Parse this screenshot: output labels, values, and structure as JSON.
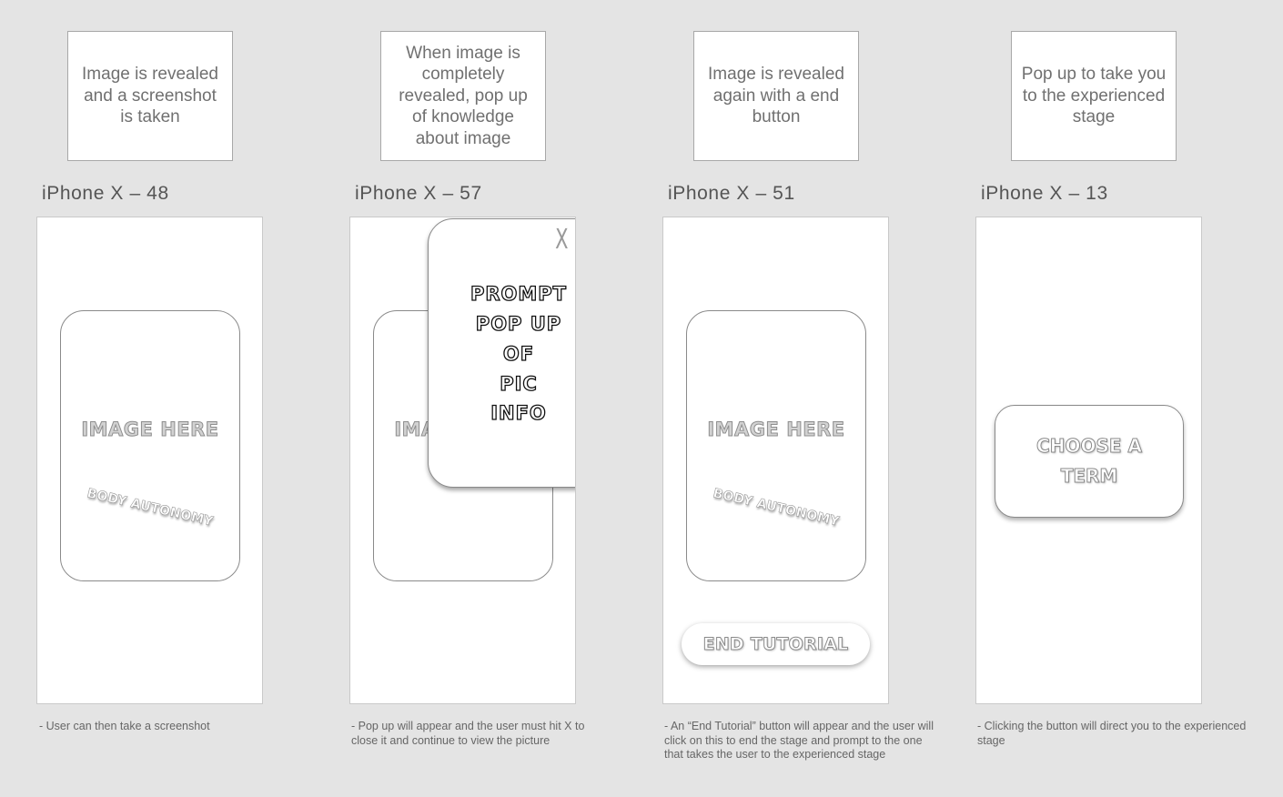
{
  "columns": [
    {
      "note": "Image is revealed and a screenshot is taken",
      "title": "iPhone X – 48",
      "image_label": "IMAGE HERE",
      "stamp": "BODY AUTONOMY",
      "caption": "- User can then take a screenshot"
    },
    {
      "note": "When image is completely revealed, pop up of knowledge about image",
      "title": "iPhone X – 57",
      "image_label": "IMAGE HERE",
      "popup": {
        "close": "X",
        "lines": [
          "PROMPT",
          "POP UP",
          "OF",
          "PIC",
          "INFO"
        ]
      },
      "caption": "- Pop up will appear and the user must hit X to close it and continue to view the picture"
    },
    {
      "note": "Image is revealed again with a end button",
      "title": "iPhone X – 51",
      "image_label": "IMAGE HERE",
      "stamp": "BODY AUTONOMY",
      "end_button": "END TUTORIAL",
      "caption": "- An “End Tutorial” button will appear and the user will click on this to end the stage and prompt to the one that takes the user to the experienced stage"
    },
    {
      "note": "Pop up to take you to the experienced stage",
      "title": "iPhone X – 13",
      "choose_button": "CHOOSE A TERM",
      "caption": "- Clicking the button will direct you to the experienced stage"
    }
  ]
}
